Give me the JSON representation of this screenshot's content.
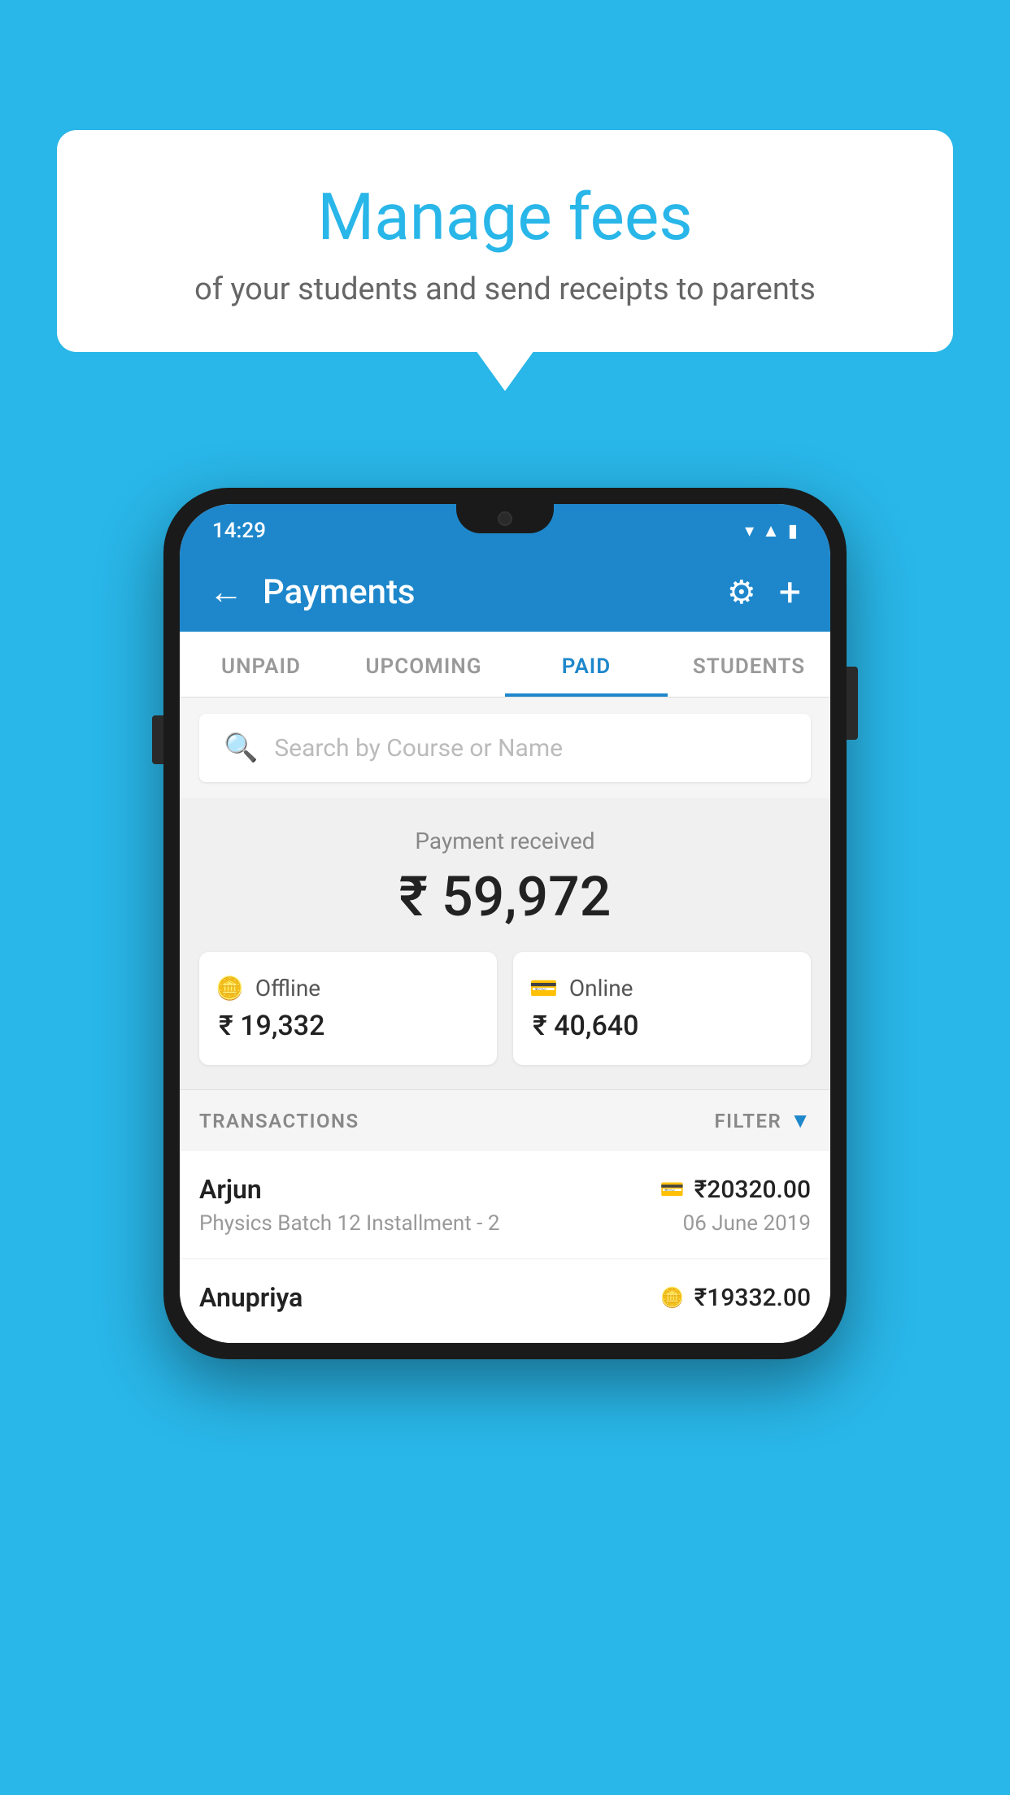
{
  "bubble": {
    "title": "Manage fees",
    "subtitle": "of your students and send receipts to parents"
  },
  "status_bar": {
    "time": "14:29",
    "icons": [
      "wifi",
      "signal",
      "battery"
    ]
  },
  "app_bar": {
    "title": "Payments",
    "back_label": "←",
    "gear_label": "⚙",
    "plus_label": "+"
  },
  "tabs": [
    {
      "label": "UNPAID",
      "active": false
    },
    {
      "label": "UPCOMING",
      "active": false
    },
    {
      "label": "PAID",
      "active": true
    },
    {
      "label": "STUDENTS",
      "active": false
    }
  ],
  "search": {
    "placeholder": "Search by Course or Name"
  },
  "payment_summary": {
    "received_label": "Payment received",
    "total_amount": "₹ 59,972",
    "offline_label": "Offline",
    "offline_amount": "₹ 19,332",
    "online_label": "Online",
    "online_amount": "₹ 40,640"
  },
  "transactions": {
    "header_label": "TRANSACTIONS",
    "filter_label": "FILTER"
  },
  "transaction_list": [
    {
      "name": "Arjun",
      "course": "Physics Batch 12 Installment - 2",
      "amount": "₹20320.00",
      "date": "06 June 2019",
      "payment_type": "card"
    },
    {
      "name": "Anupriya",
      "course": "",
      "amount": "₹19332.00",
      "date": "",
      "payment_type": "offline"
    }
  ]
}
